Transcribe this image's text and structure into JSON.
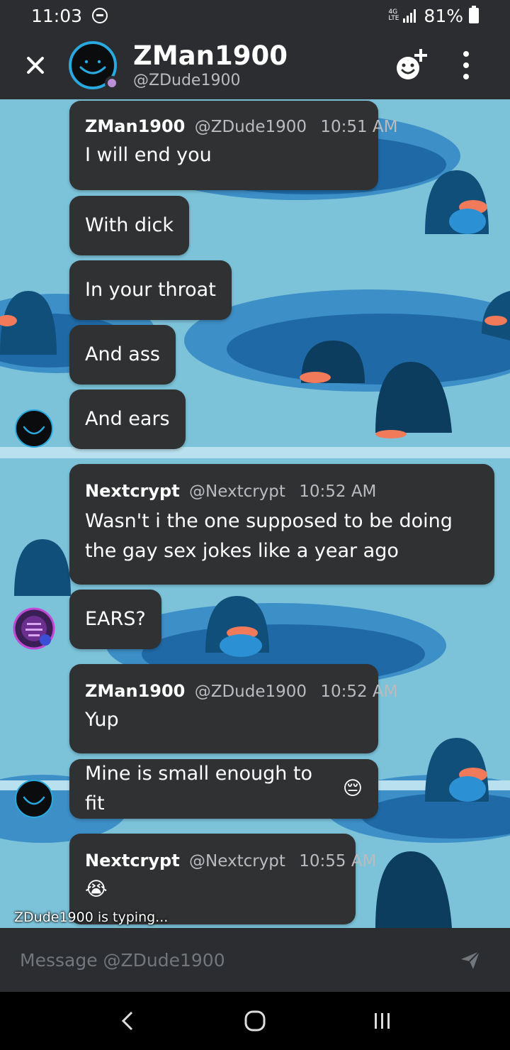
{
  "status_bar": {
    "time": "11:03",
    "network": "4G LTE",
    "battery": "81%"
  },
  "header": {
    "title": "ZMan1900",
    "subtitle": "@ZDude1900",
    "status_color": "#b98fd6"
  },
  "messages": [
    {
      "author": "ZMan1900",
      "handle": "@ZDude1900",
      "time": "10:51 AM",
      "lines": [
        "I will end you"
      ]
    },
    {
      "text": "With dick"
    },
    {
      "text": "In your throat"
    },
    {
      "text": "And ass"
    },
    {
      "text": "And ears"
    },
    {
      "author": "Nextcrypt",
      "handle": "@Nextcrypt",
      "time": "10:52 AM",
      "lines": [
        "Wasn't i the one supposed to be doing",
        "the gay sex jokes like a year ago"
      ]
    },
    {
      "text": "EARS?"
    },
    {
      "author": "ZMan1900",
      "handle": "@ZDude1900",
      "time": "10:52 AM",
      "lines": [
        "Yup"
      ]
    },
    {
      "text": "Mine is small enough to fit",
      "emoji": "😔"
    },
    {
      "author": "Nextcrypt",
      "handle": "@Nextcrypt",
      "time": "10:55 AM",
      "emoji": "😭"
    }
  ],
  "typing_indicator": "ZDude1900 is typing...",
  "composer": {
    "placeholder": "Message @ZDude1900"
  },
  "colors": {
    "bar_bg": "#2b2d30",
    "bubble_bg": "#2f3133",
    "wallpaper_bg": "#79c0d9",
    "avatar_ring": "#28a9e0"
  }
}
